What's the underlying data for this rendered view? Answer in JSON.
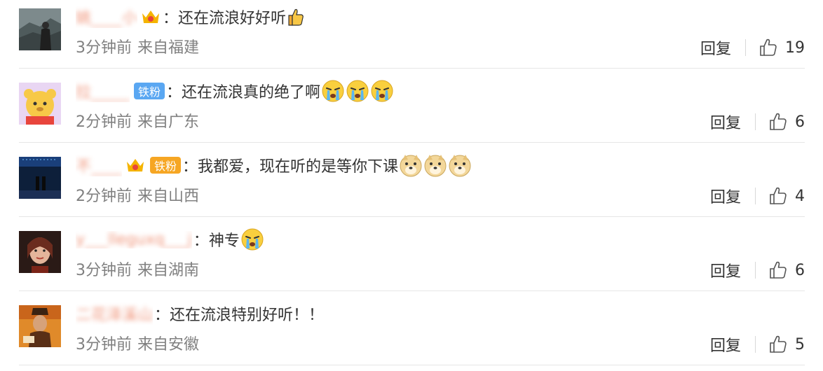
{
  "colors": {
    "username": "#eb7350",
    "meta_text": "#808080",
    "body_text": "#333333",
    "fan_badge_blue": "#5aa7f2",
    "fan_badge_gold": "#f6a623",
    "divider": "#e6e6e6"
  },
  "comments": [
    {
      "username": "姚____小",
      "has_crown": true,
      "fan_badge": "",
      "colon": "：",
      "text": "还在流浪好好听",
      "emojis": [
        "thumbs-up-emoji"
      ],
      "time": "3分钟前",
      "location": "来自福建",
      "reply_label": "回复",
      "likes": "19"
    },
    {
      "username": "拉_____",
      "has_crown": false,
      "fan_badge": "铁粉",
      "colon": "：",
      "text": "还在流浪真的绝了啊",
      "emojis": [
        "crying-emoji",
        "crying-emoji",
        "crying-emoji"
      ],
      "time": "2分钟前",
      "location": "来自广东",
      "reply_label": "回复",
      "likes": "6"
    },
    {
      "username": "不____",
      "has_crown": true,
      "fan_badge": "铁粉",
      "colon": "：",
      "text": "我都爱，现在听的是等你下课",
      "emojis": [
        "doge-emoji",
        "doge-emoji",
        "doge-emoji"
      ],
      "time": "2分钟前",
      "location": "来自山西",
      "reply_label": "回复",
      "likes": "4"
    },
    {
      "username": "y___lleguxq___j",
      "has_crown": false,
      "fan_badge": "",
      "colon": "：",
      "text": "神专",
      "emojis": [
        "crying-emoji"
      ],
      "time": "3分钟前",
      "location": "来自湖南",
      "reply_label": "回复",
      "likes": "6"
    },
    {
      "username": "二花泽溪山",
      "has_crown": false,
      "fan_badge": "",
      "colon": "：",
      "text": "还在流浪特别好听！！",
      "emojis": [],
      "time": "3分钟前",
      "location": "来自安徽",
      "reply_label": "回复",
      "likes": "5"
    }
  ]
}
